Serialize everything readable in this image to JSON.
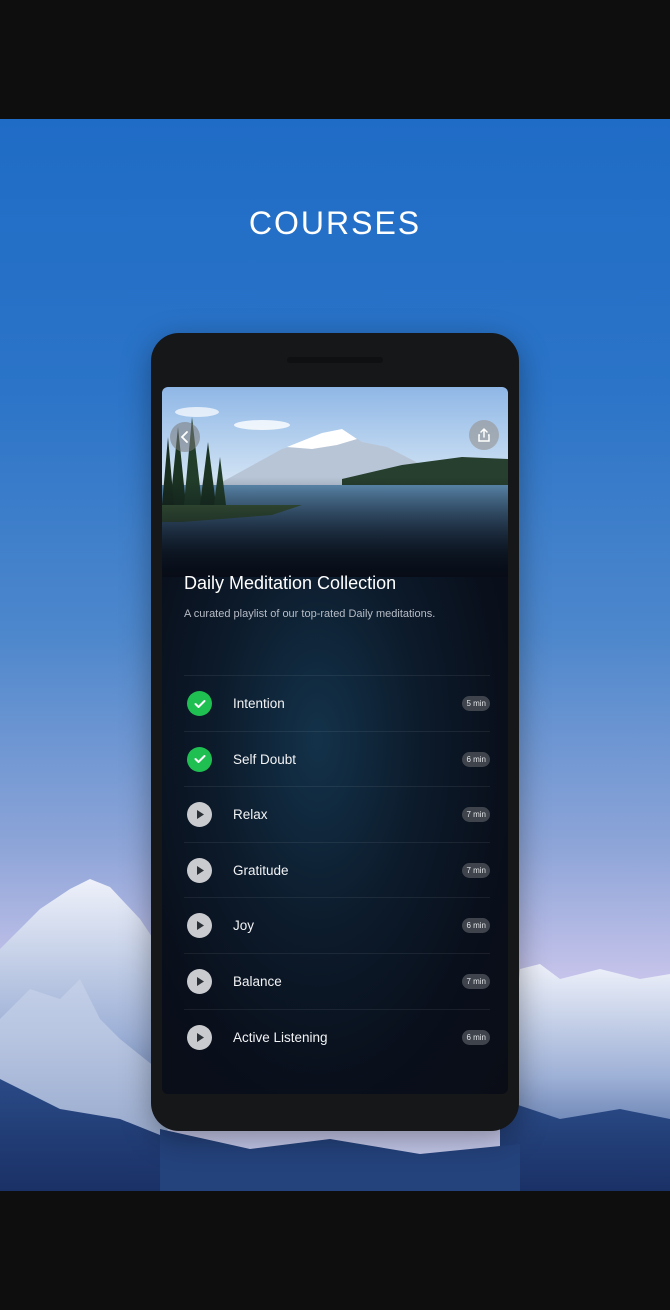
{
  "page": {
    "heading": "COURSES"
  },
  "course": {
    "title": "Daily Meditation Collection",
    "description": "A curated playlist of our top-rated Daily meditations.",
    "back_icon": "chevron-left-icon",
    "share_icon": "share-icon"
  },
  "sessions": [
    {
      "label": "Intention",
      "duration": "5 min",
      "status": "completed",
      "icon": "check-icon"
    },
    {
      "label": "Self Doubt",
      "duration": "6 min",
      "status": "completed",
      "icon": "check-icon"
    },
    {
      "label": "Relax",
      "duration": "7 min",
      "status": "play",
      "icon": "play-icon"
    },
    {
      "label": "Gratitude",
      "duration": "7 min",
      "status": "play",
      "icon": "play-icon"
    },
    {
      "label": "Joy",
      "duration": "6 min",
      "status": "play",
      "icon": "play-icon"
    },
    {
      "label": "Balance",
      "duration": "7 min",
      "status": "play",
      "icon": "play-icon"
    },
    {
      "label": "Active Listening",
      "duration": "6 min",
      "status": "play",
      "icon": "play-icon"
    }
  ],
  "colors": {
    "completed": "#1fbf52",
    "background_sky": "#1f6cc6",
    "phone_body": "#161719"
  }
}
